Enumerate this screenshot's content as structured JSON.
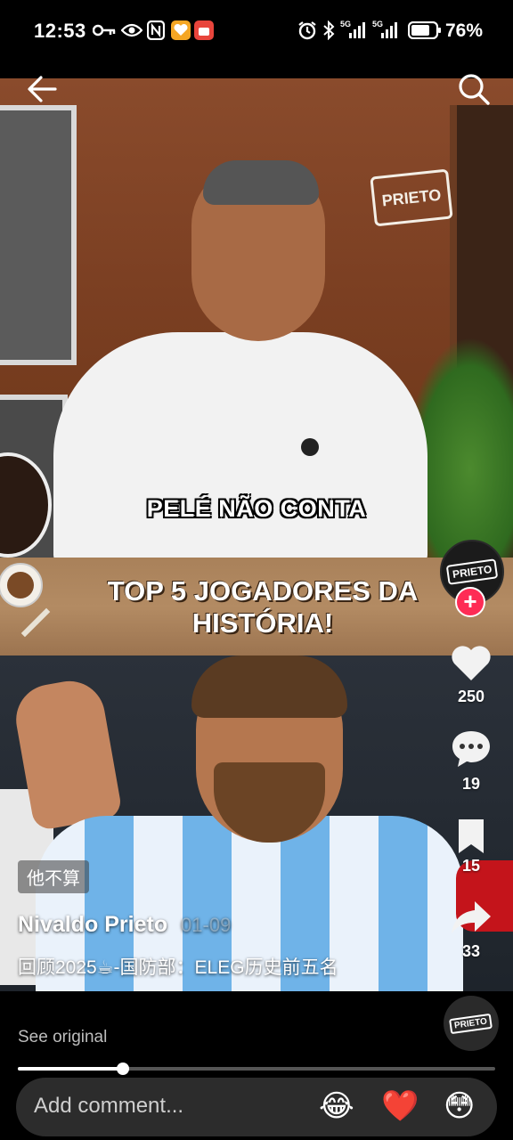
{
  "status_bar": {
    "time": "12:53",
    "battery_percent": "76%",
    "network_1": "5G",
    "network_2": "5G"
  },
  "video": {
    "caption": "PELÉ NÃO CONTA",
    "brand_logo": "PRIETO",
    "banner_title_line1": "TOP 5 JOGADORES DA",
    "banner_title_line2": "HISTÓRIA!",
    "progress": 0.22
  },
  "side_actions": {
    "avatar_logo": "PRIETO",
    "likes": "250",
    "comments": "19",
    "favorites": "15",
    "shares": "33"
  },
  "post": {
    "tag": "他不算",
    "author": "Nivaldo Prieto",
    "date_faded": "01-09",
    "description": "回顾2025☕-国防部：ELEG历史前五名",
    "see_original": "See original",
    "music_logo": "PRIETO"
  },
  "comment_bar": {
    "placeholder": "Add comment...",
    "emoji_1": "😂",
    "emoji_2": "❤️",
    "emoji_3": "😳"
  },
  "colors": {
    "follow": "#fe2c55",
    "background": "#000000"
  }
}
